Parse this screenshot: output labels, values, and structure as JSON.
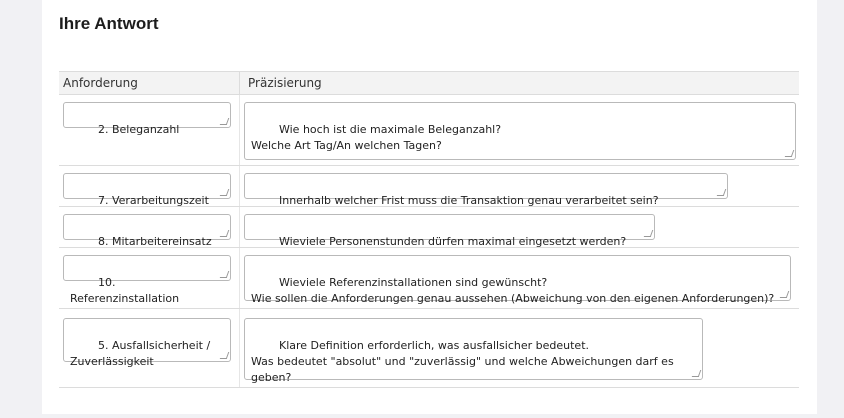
{
  "section_title": "Ihre Antwort",
  "table": {
    "headers": [
      "Anforderung",
      "Präzisierung"
    ],
    "rows": [
      {
        "requirement": "2. Beleganzahl",
        "detail": "Wie hoch ist die maximale Beleganzahl?\nWelche Art Tag/An welchen Tagen?"
      },
      {
        "requirement": "7. Verarbeitungszeit",
        "detail": "Innerhalb welcher Frist muss die Transaktion genau verarbeitet sein?"
      },
      {
        "requirement": "8. Mitarbeitereinsatz",
        "detail": "Wieviele Personenstunden dürfen maximal eingesetzt werden?"
      },
      {
        "requirement": "10. Referenzinstallation",
        "detail": "Wieviele Referenzinstallationen sind gewünscht?\nWie sollen die Anforderungen genau aussehen (Abweichung von den eigenen Anforderungen)?"
      },
      {
        "requirement": "5. Ausfallsicherheit /\nZuverlässigkeit",
        "detail": "Klare Definition erforderlich, was ausfallsicher bedeutet.\nWas bedeutet \"absolut\" und \"zuverlässig\" und welche Abweichungen darf es\ngeben?"
      }
    ]
  }
}
